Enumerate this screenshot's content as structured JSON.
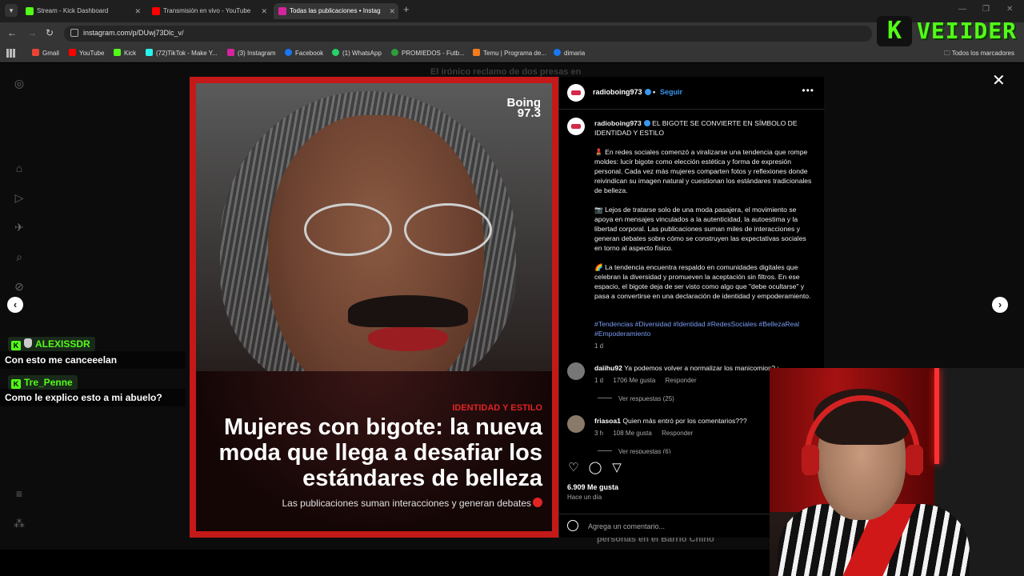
{
  "browser": {
    "tabs": [
      {
        "title": "Stream - Kick Dashboard",
        "favicon_color": "#53fc18"
      },
      {
        "title": "Transmisión en vivo - YouTube",
        "favicon_color": "#ff0000"
      },
      {
        "title": "Todas las publicaciones • Instag",
        "favicon_color": "#d6249f"
      }
    ],
    "url": "instagram.com/p/DUwj73Dlc_v/",
    "bookmarks": [
      {
        "label": "Gmail",
        "color": "#ea4335"
      },
      {
        "label": "YouTube",
        "color": "#ff0000"
      },
      {
        "label": "Kick",
        "color": "#53fc18"
      },
      {
        "label": "(72)TikTok - Make Y...",
        "color": "#25f4ee"
      },
      {
        "label": "(3) Instagram",
        "color": "#d6249f"
      },
      {
        "label": "Facebook",
        "color": "#1877f2"
      },
      {
        "label": "(1) WhatsApp",
        "color": "#25d366"
      },
      {
        "label": "PROMIEDOS - Futb...",
        "color": "#2e9d3a"
      },
      {
        "label": "Temu | Programa de...",
        "color": "#f57c1f"
      },
      {
        "label": "dimaria",
        "color": "#1877f2"
      }
    ],
    "all_bookmarks": "Todos los marcadores"
  },
  "overlay": {
    "kick_letter": "K",
    "streamer_name": "VEIIDER",
    "accent_color": "#53fc18"
  },
  "background": {
    "text_1": "El irónico reclamo de dos presas en",
    "text_2": "personas en el Barrio Chino"
  },
  "post": {
    "brand_line_1": "Boing",
    "brand_line_2": "97.3",
    "tag": "IDENTIDAD Y ESTILO",
    "headline": "Mujeres con bigote: la nueva moda que llega a desafiar los estándares de belleza",
    "subheadline": "Las publicaciones suman interacciones y generan debates"
  },
  "panel": {
    "username": "radioboing973",
    "follow": "Seguir",
    "caption_title": "EL BIGOTE SE CONVIERTE EN SÍMBOLO DE IDENTIDAD Y ESTILO",
    "paragraphs": [
      "💄 En redes sociales comenzó a viralizarse una tendencia que rompe moldes: lucir bigote como elección estética y forma de expresión personal. Cada vez más mujeres comparten fotos y reflexiones donde reivindican su imagen natural y cuestionan los estándares tradicionales de belleza.",
      "📷 Lejos de tratarse solo de una moda pasajera, el movimiento se apoya en mensajes vinculados a la autenticidad, la autoestima y la libertad corporal. Las publicaciones suman miles de interacciones y generan debates sobre cómo se construyen las expectativas sociales en torno al aspecto físico.",
      "🌈 La tendencia encuentra respaldo en comunidades digitales que celebran la diversidad y promueven la aceptación sin filtros. En ese espacio, el bigote deja de ser visto como algo que \"debe ocultarse\" y pasa a convertirse en una declaración de identidad y empoderamiento."
    ],
    "hashtags": "#Tendencias #Diversidad #Identidad #RedesSociales #BellezaReal #Empoderamiento",
    "caption_time": "1 d",
    "comments": [
      {
        "user": "daiihu92",
        "text": "Ya podemos volver a normalizar los manicomios? 😂",
        "time": "1 d",
        "likes": "1706 Me gusta",
        "reply": "Responder",
        "replies": "Ver respuestas (25)"
      },
      {
        "user": "friasoa1",
        "text": "Quien más entró por los comentarios???",
        "time": "3 h",
        "likes": "108 Me gusta",
        "reply": "Responder",
        "replies": "Ver respuestas (6)"
      }
    ],
    "likes_total": "6.909 Me gusta",
    "posted_ago": "Hace un día",
    "comment_placeholder": "Agrega un comentario..."
  },
  "chat": [
    {
      "user": "ALEXISSDR",
      "message": "Con esto me canceeelan"
    },
    {
      "user": "Tre_Penne",
      "message": "Como le explico esto a mi abuelo?"
    }
  ]
}
